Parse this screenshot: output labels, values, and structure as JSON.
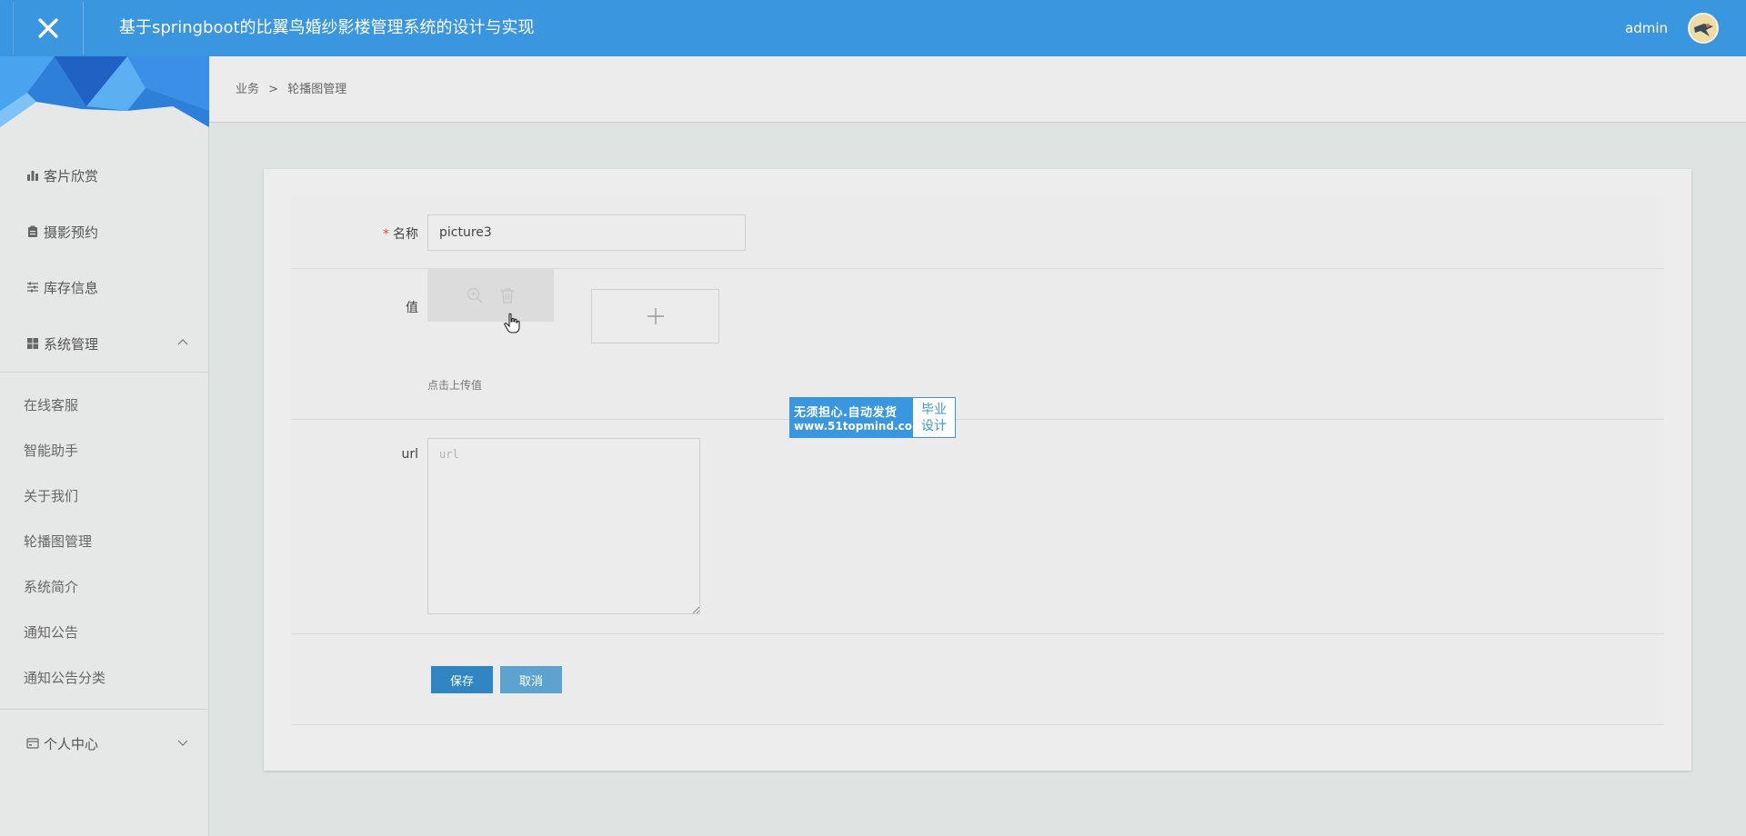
{
  "header": {
    "title": "基于springboot的比翼鸟婚纱影楼管理系统的设计与实现",
    "user": "admin"
  },
  "sidebar": {
    "items": [
      {
        "label": "客片欣赏",
        "icon": "bar-chart-icon"
      },
      {
        "label": "摄影预约",
        "icon": "clipboard-icon"
      },
      {
        "label": "库存信息",
        "icon": "sliders-icon"
      },
      {
        "label": "系统管理",
        "icon": "grid-icon"
      }
    ],
    "system_sub_items": [
      "在线客服",
      "智能助手",
      "关于我们",
      "轮播图管理",
      "系统简介",
      "通知公告",
      "通知公告分类"
    ],
    "personal_center": "个人中心"
  },
  "breadcrumb": {
    "parent": "业务",
    "separator": ">",
    "current": "轮播图管理"
  },
  "form": {
    "name_label": "名称",
    "name_value": "picture3",
    "value_label": "值",
    "upload_hint": "点击上传值",
    "url_label": "url",
    "url_placeholder": "url",
    "save_label": "保存",
    "cancel_label": "取消"
  },
  "watermark": {
    "line1": "无须担心.自动发货",
    "line2": "www.51topmind.com",
    "right1": "毕业",
    "right2": "设计"
  },
  "colors": {
    "header_bg": "#3a96de",
    "save_button": "#2f86c2",
    "cancel_button": "#5ca4cf",
    "required": "#e05252"
  }
}
